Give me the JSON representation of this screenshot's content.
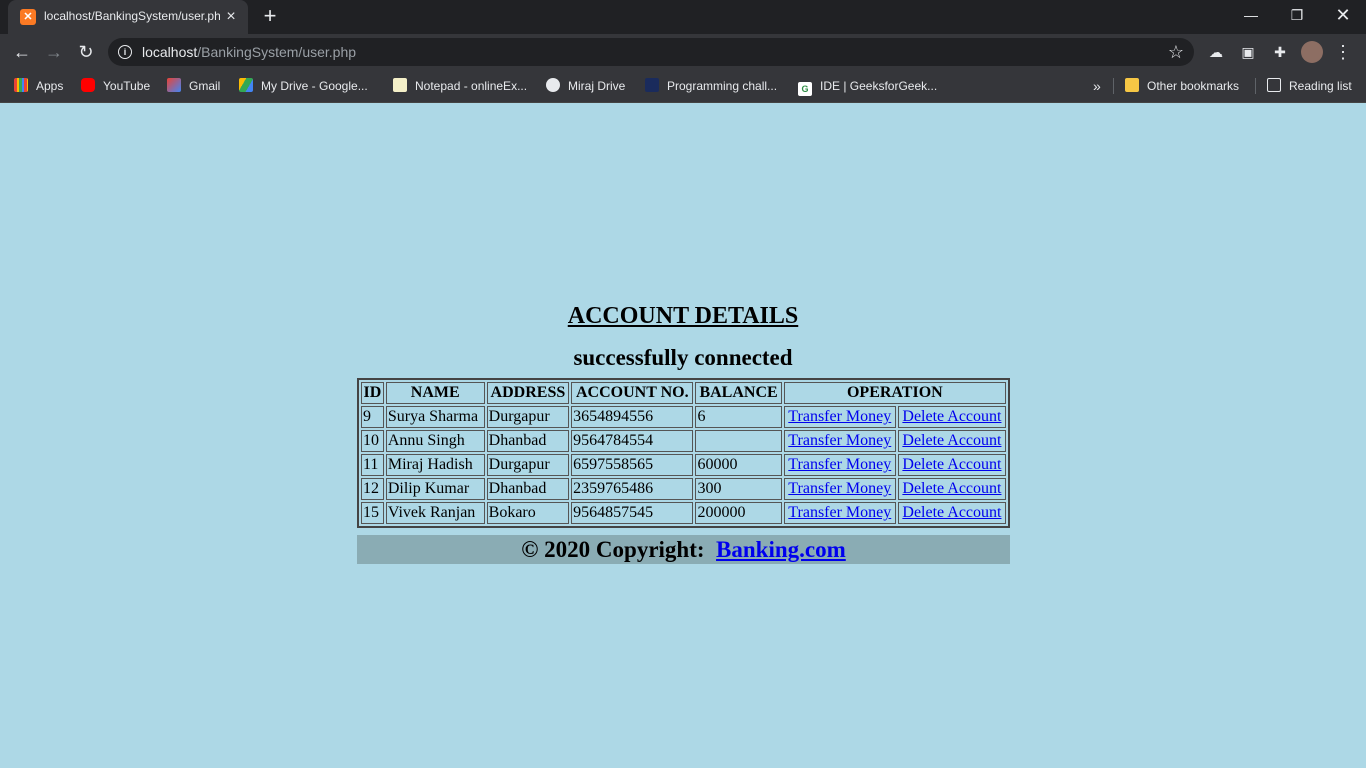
{
  "browser": {
    "tab_title": "localhost/BankingSystem/user.php",
    "url_host": "localhost",
    "url_path": "/BankingSystem/user.php",
    "bookmarks": [
      {
        "label": "Apps"
      },
      {
        "label": "YouTube"
      },
      {
        "label": "Gmail"
      },
      {
        "label": "My Drive - Google..."
      },
      {
        "label": "Notepad - onlineEx..."
      },
      {
        "label": "Miraj Drive"
      },
      {
        "label": "Programming chall..."
      },
      {
        "label": "IDE | GeeksforGeek..."
      }
    ],
    "overflow": "»",
    "other_bookmarks": "Other bookmarks",
    "reading_list": "Reading list"
  },
  "page": {
    "heading": "ACCOUNT DETAILS",
    "status": "successfully connected",
    "table": {
      "headers": [
        "ID",
        "NAME",
        "ADDRESS",
        "ACCOUNT NO.",
        "BALANCE",
        "OPERATION"
      ],
      "rows": [
        {
          "id": "9",
          "name": "Surya Sharma",
          "address": "Durgapur",
          "account_no": "3654894556",
          "balance": "6"
        },
        {
          "id": "10",
          "name": "Annu Singh",
          "address": "Dhanbad",
          "account_no": "9564784554",
          "balance": ""
        },
        {
          "id": "11",
          "name": "Miraj Hadish",
          "address": "Durgapur",
          "account_no": "6597558565",
          "balance": "60000"
        },
        {
          "id": "12",
          "name": "Dilip Kumar",
          "address": "Dhanbad",
          "account_no": "2359765486",
          "balance": "300"
        },
        {
          "id": "15",
          "name": "Vivek Ranjan",
          "address": "Bokaro",
          "account_no": "9564857545",
          "balance": "200000"
        }
      ],
      "transfer_label": "Transfer Money",
      "delete_label": "Delete Account"
    },
    "footer_text": "© 2020 Copyright:",
    "footer_link": "Banking.com"
  },
  "colors": {
    "page_bg": "#add8e6",
    "footer_bg": "#8aacb4",
    "link": "#0000ee",
    "chrome_dark": "#202124",
    "chrome_mid": "#35363a"
  }
}
